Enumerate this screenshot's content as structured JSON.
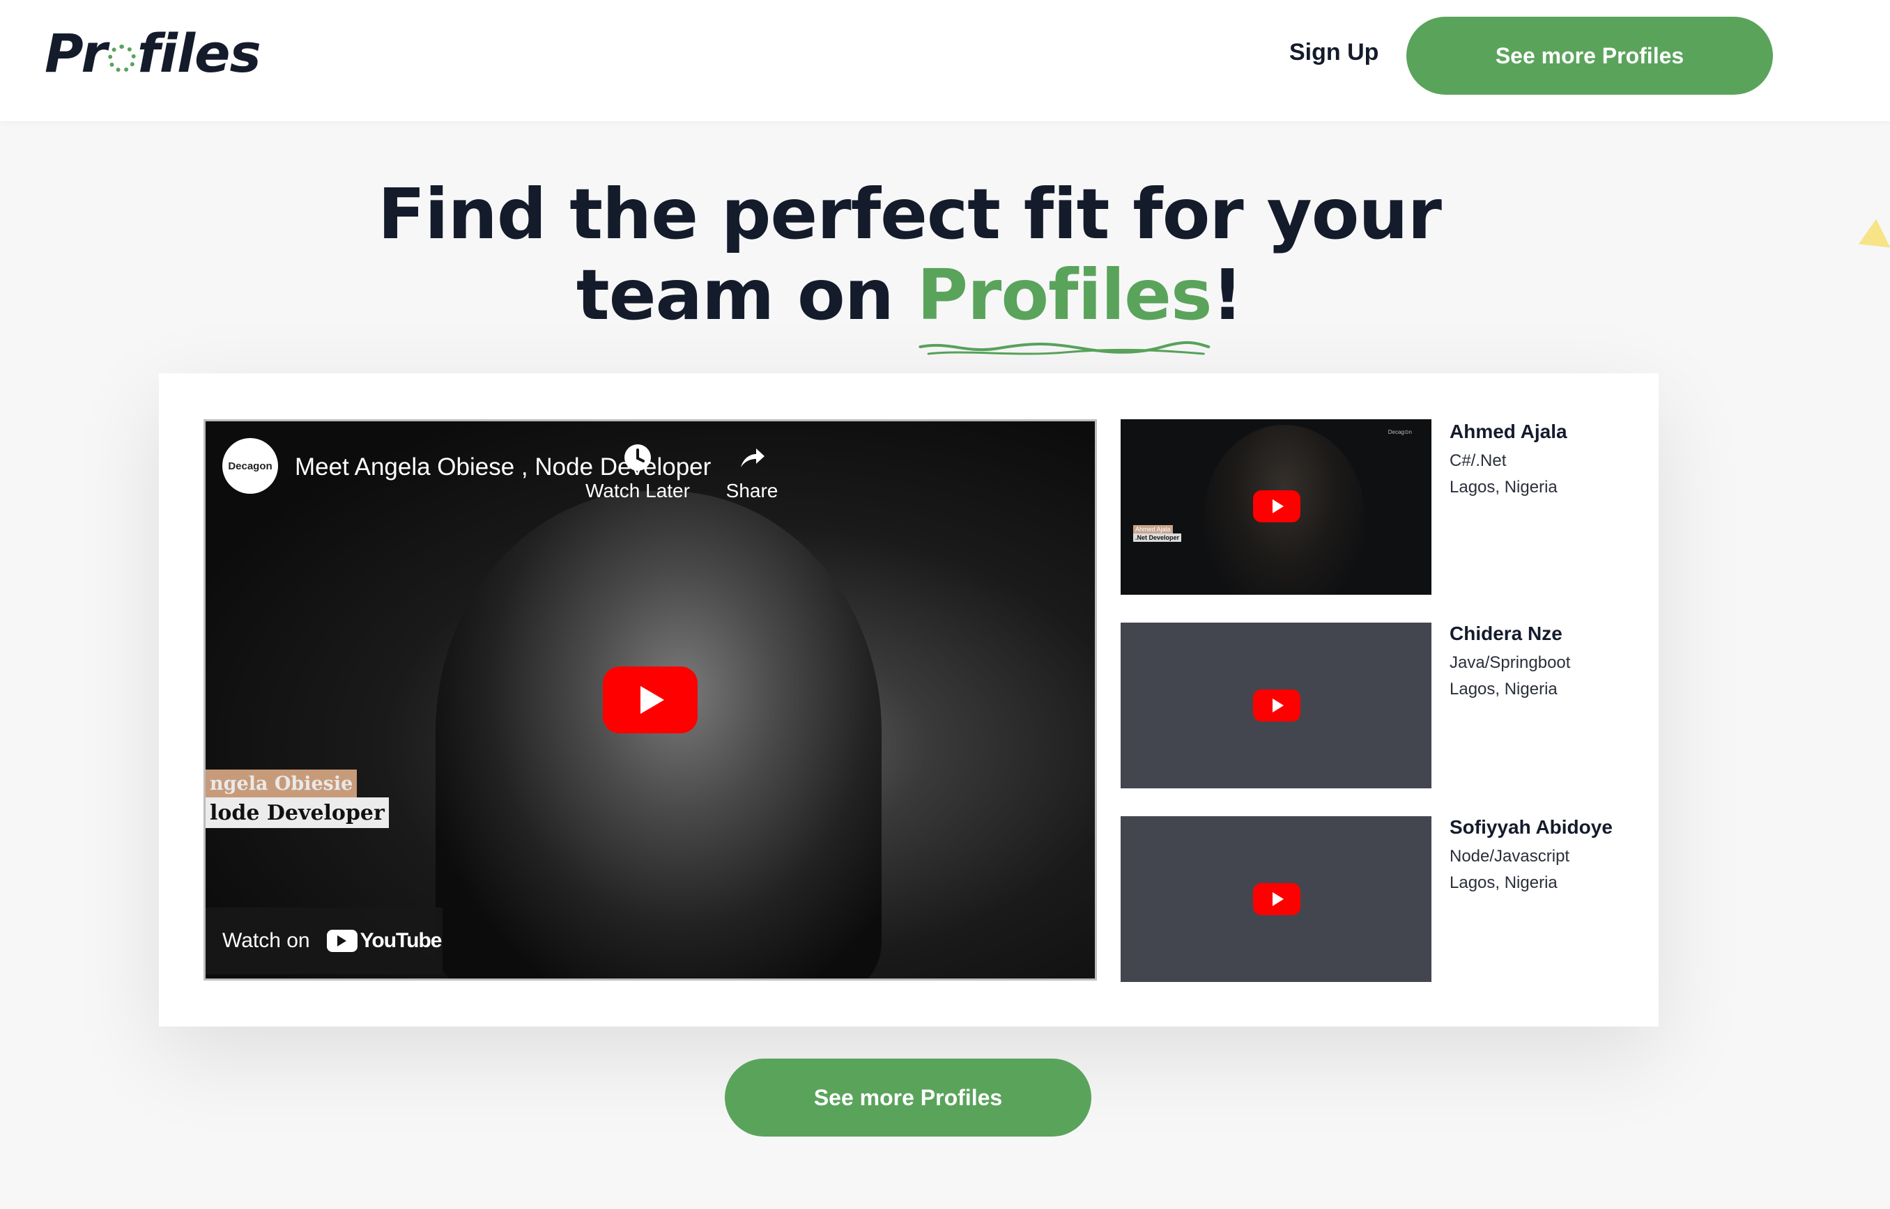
{
  "header": {
    "logo_pre": "Pr",
    "logo_post": "files",
    "signup_label": "Sign Up",
    "cta_label": "See more Profiles"
  },
  "hero": {
    "line1": "Find the perfect fit for your",
    "line2_pre": "team on ",
    "highlight": "Profiles",
    "line2_post": "!"
  },
  "main_video": {
    "channel": "Decagon",
    "title": "Meet Angela Obiese , Node Developer",
    "watch_later_label": "Watch Later",
    "share_label": "Share",
    "share_overlay": "Decagon",
    "lower_third_name": "ngela Obiesie",
    "lower_third_role": "lode Developer",
    "watch_on_label": "Watch on",
    "youtube_word": "YouTube"
  },
  "profiles": [
    {
      "name": "Ahmed Ajala",
      "stack": "C#/.Net",
      "location": "Lagos, Nigeria",
      "thumb_label_name": "Ahmed Ajala",
      "thumb_label_role": ".Net Developer",
      "thumb_logo": "Decag⊙n"
    },
    {
      "name": "Chidera Nze",
      "stack": "Java/Springboot",
      "location": "Lagos, Nigeria"
    },
    {
      "name": "Sofiyyah Abidoye",
      "stack": "Node/Javascript",
      "location": "Lagos, Nigeria"
    }
  ],
  "bottom_cta_label": "See more Profiles",
  "colors": {
    "accent": "#5aa35b",
    "text": "#141b2b",
    "youtube_red": "#ff0000",
    "thumb_bg": "#43464f"
  }
}
